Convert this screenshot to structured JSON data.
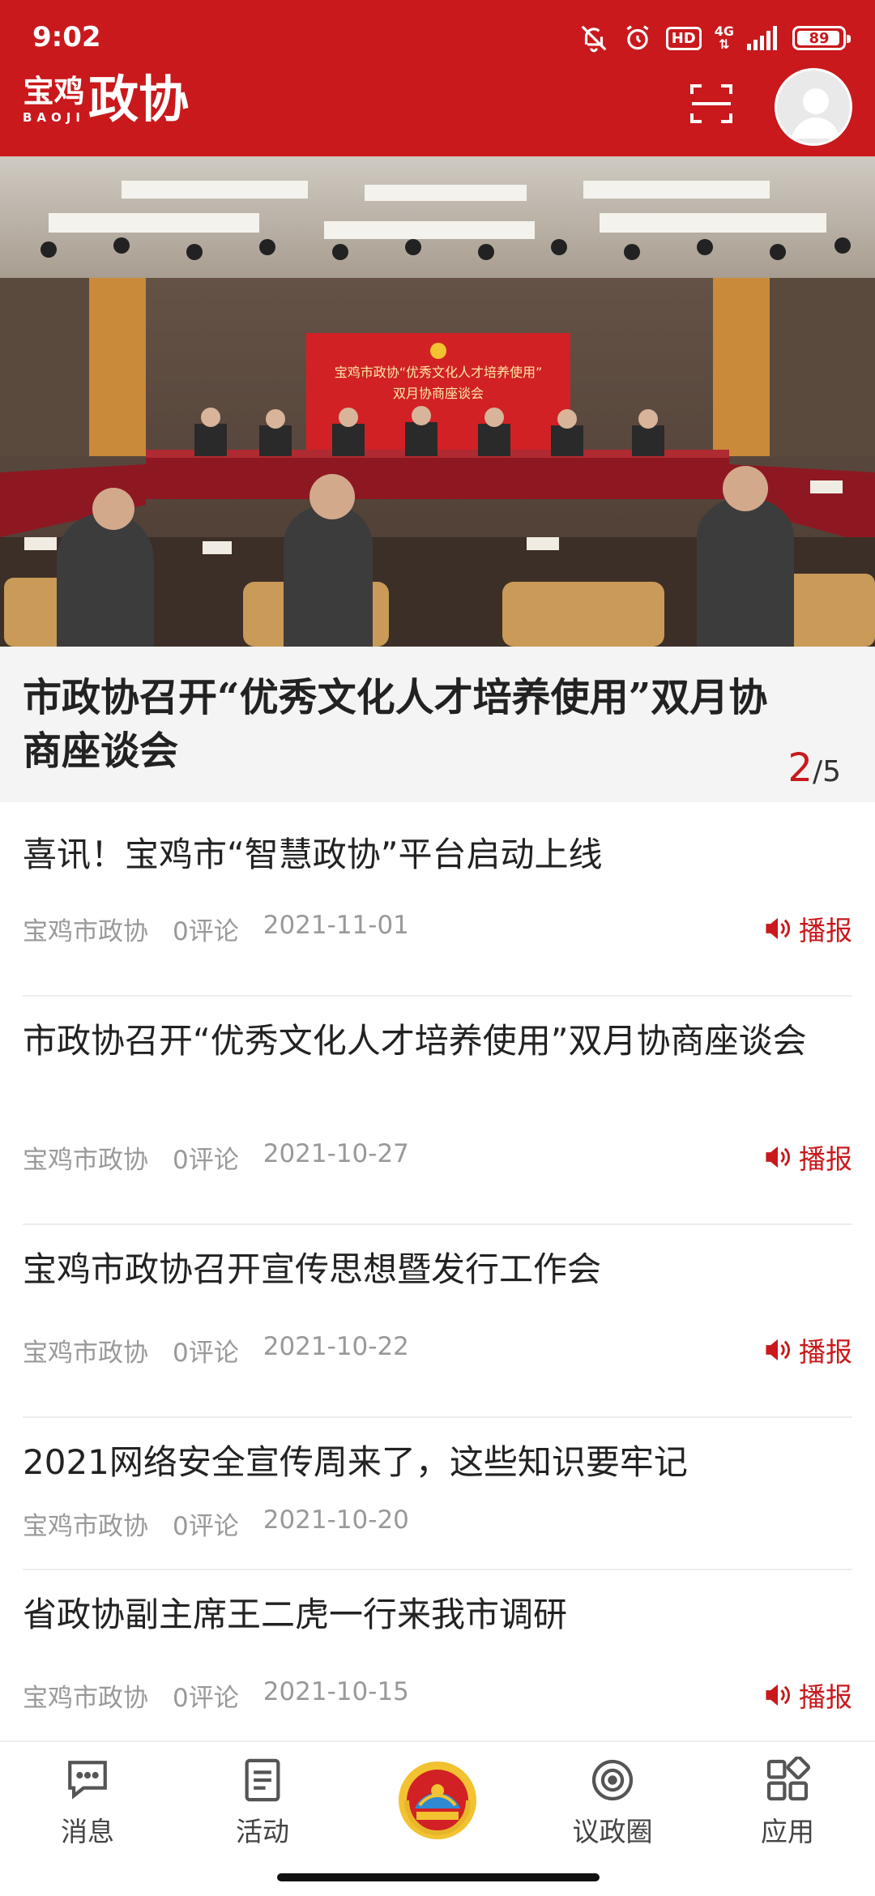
{
  "status_bar": {
    "time": "9:02",
    "hd_label": "HD",
    "network_label": "4G",
    "battery": "89",
    "icons": [
      "bell-off-icon",
      "alarm-icon",
      "hd-icon",
      "signal-icon",
      "battery-icon"
    ]
  },
  "app_bar": {
    "logo_small": "宝鸡",
    "logo_pinyin": "BAOJI",
    "logo_big": "政协",
    "icons": [
      "scan-icon",
      "avatar"
    ]
  },
  "hero": {
    "banner_text_line1": "宝鸡市政协“优秀文化人才培养使用”",
    "banner_text_line2": "双月协商座谈会",
    "title": "市政协召开“优秀文化人才培养使用”双月协商座谈会",
    "pager_current": "2",
    "pager_total": "/5"
  },
  "news": [
    {
      "title": "喜讯！宝鸡市“智慧政协”平台启动上线",
      "source": "宝鸡市政协",
      "comments": "0评论",
      "date": "2021-11-01",
      "broadcast": "播报"
    },
    {
      "title": "市政协召开“优秀文化人才培养使用”双月协商座谈会",
      "source": "宝鸡市政协",
      "comments": "0评论",
      "date": "2021-10-27",
      "broadcast": "播报"
    },
    {
      "title": "宝鸡市政协召开宣传思想暨发行工作会",
      "source": "宝鸡市政协",
      "comments": "0评论",
      "date": "2021-10-22",
      "broadcast": "播报"
    },
    {
      "title": "2021网络安全宣传周来了，这些知识要牢记",
      "source": "宝鸡市政协",
      "comments": "0评论",
      "date": "2021-10-20",
      "broadcast": ""
    },
    {
      "title": "省政协副主席王二虎一行来我市调研",
      "source": "宝鸡市政协",
      "comments": "0评论",
      "date": "2021-10-15",
      "broadcast": "播报"
    }
  ],
  "bottom_nav": [
    {
      "label": "消息",
      "icon": "message-icon"
    },
    {
      "label": "活动",
      "icon": "activity-icon"
    },
    {
      "label": "",
      "icon": "cppcc-emblem-icon"
    },
    {
      "label": "议政圈",
      "icon": "circle-icon"
    },
    {
      "label": "应用",
      "icon": "apps-icon"
    }
  ],
  "colors": {
    "brand_red": "#c9191c",
    "meta_gray": "#999999",
    "title_dark": "#222222",
    "caption_bg": "#f4f4f4"
  }
}
